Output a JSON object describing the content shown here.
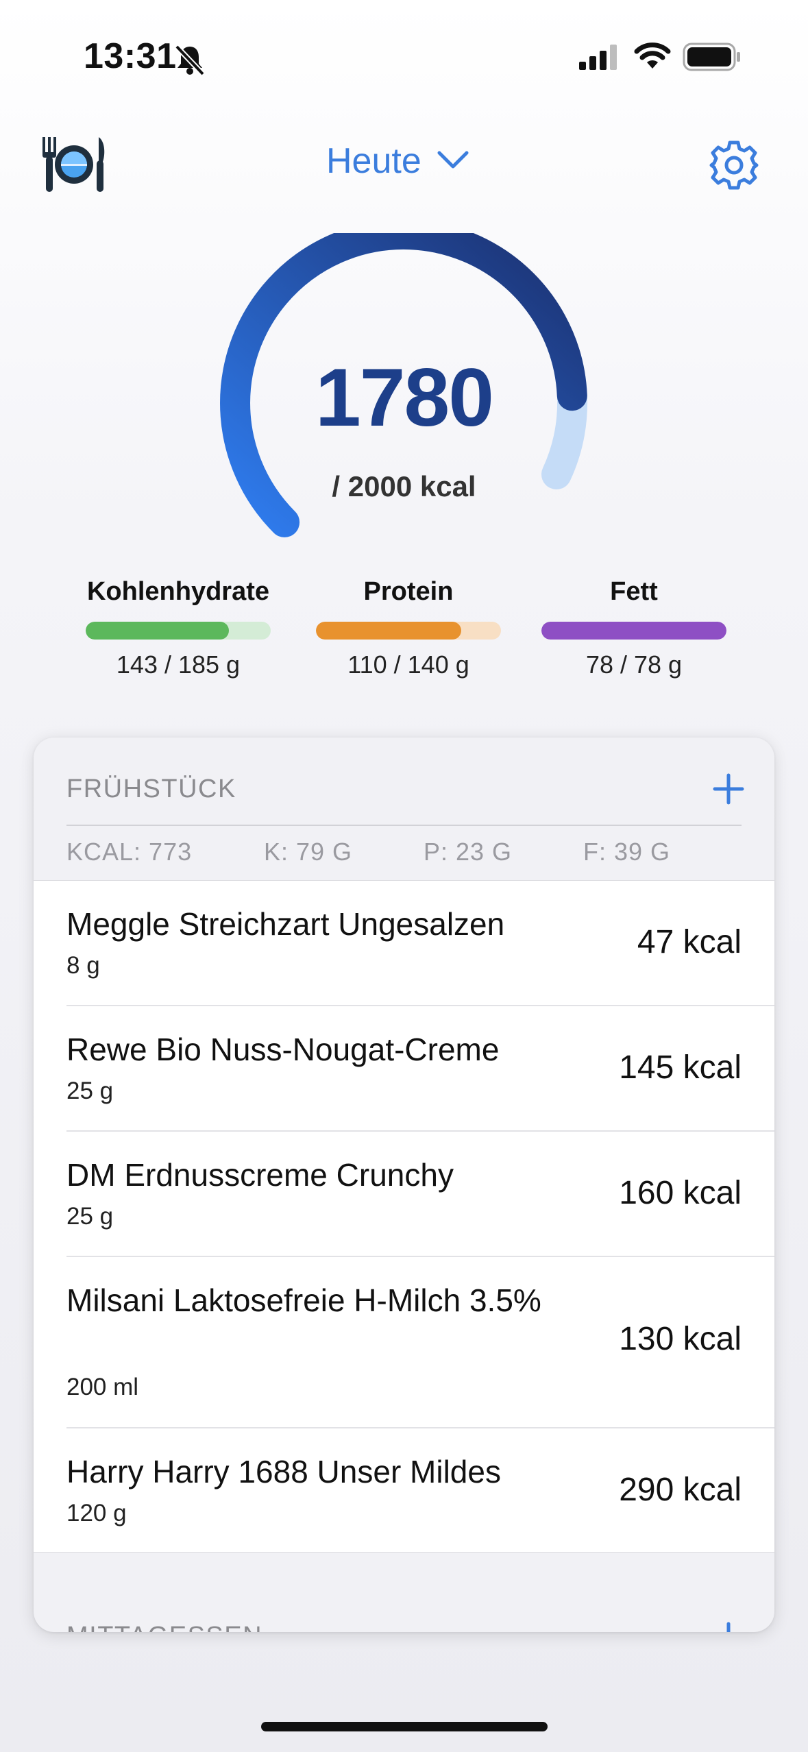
{
  "status_bar": {
    "time": "13:31"
  },
  "header": {
    "date_label": "Heute"
  },
  "summary": {
    "consumed": 1780,
    "consumed_label": "1780",
    "goal_label": "/ 2000 kcal",
    "goal": 2000,
    "progress": 0.89
  },
  "macros": [
    {
      "title": "Kohlenhydrate",
      "amount": "143 / 185 g",
      "progress": 0.773,
      "color": "#5cb85c",
      "track": "#d4ecd6"
    },
    {
      "title": "Protein",
      "amount": "110 / 140 g",
      "progress": 0.786,
      "color": "#e8922e",
      "track": "#f8dfc4"
    },
    {
      "title": "Fett",
      "amount": "78 / 78 g",
      "progress": 1.0,
      "color": "#8e4fc4",
      "track": "#e4d3f3"
    }
  ],
  "breakfast": {
    "title": "FRÜHSTÜCK",
    "sums": {
      "kcal": "KCAL: 773",
      "carbs": "K: 79 G",
      "protein": "P: 23 G",
      "fat": "F: 39 G"
    },
    "items": [
      {
        "name": "Meggle Streichzart Ungesalzen",
        "qty": "8 g",
        "kcal": "47 kcal"
      },
      {
        "name": "Rewe Bio Nuss-Nougat-Creme",
        "qty": "25 g",
        "kcal": "145 kcal"
      },
      {
        "name": "DM Erdnusscreme Crunchy",
        "qty": "25 g",
        "kcal": "160 kcal"
      },
      {
        "name": "Milsani Laktosefreie H-Milch 3.5%",
        "qty": "200 ml",
        "kcal": "130 kcal"
      },
      {
        "name": "Harry Harry 1688 Unser Mildes",
        "qty": "120 g",
        "kcal": "290 kcal"
      }
    ]
  },
  "lunch": {
    "title": "MITTAGESSEN"
  },
  "colors": {
    "accent": "#3b7ddd",
    "gauge_start": "#2f7df0",
    "gauge_end": "#1b2f6e",
    "gauge_track": "#c5dcf7"
  }
}
